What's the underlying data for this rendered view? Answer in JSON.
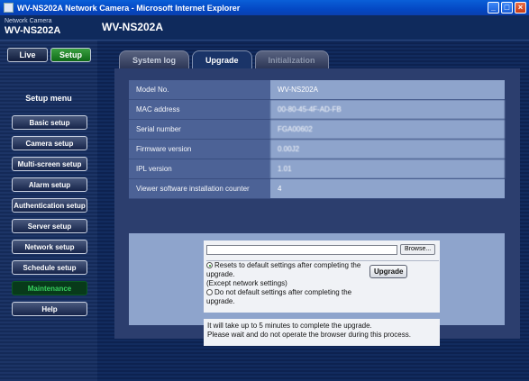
{
  "window": {
    "title": "WV-NS202A Network Camera - Microsoft Internet Explorer",
    "buttons": [
      "_",
      "□",
      "×"
    ]
  },
  "header": {
    "brand_small": "Network Camera",
    "brand_model": "WV-NS202A",
    "page_title": "WV-NS202A"
  },
  "modes": {
    "live": "Live",
    "setup": "Setup"
  },
  "sidebar": {
    "menu_label": "Setup menu",
    "items": [
      {
        "label": "Basic setup"
      },
      {
        "label": "Camera setup"
      },
      {
        "label": "Multi-screen setup"
      },
      {
        "label": "Alarm setup"
      },
      {
        "label": "Authentication setup"
      },
      {
        "label": "Server setup"
      },
      {
        "label": "Network setup"
      },
      {
        "label": "Schedule setup"
      },
      {
        "label": "Maintenance"
      },
      {
        "label": "Help"
      }
    ]
  },
  "tabs": [
    {
      "label": "System log"
    },
    {
      "label": "Upgrade"
    },
    {
      "label": "Initialization"
    }
  ],
  "info": {
    "rows": [
      {
        "label": "Model No.",
        "value": "WV-NS202A"
      },
      {
        "label": "MAC address",
        "value": "00-80-45-4F-AD-FB"
      },
      {
        "label": "Serial number",
        "value": "FGA00602"
      },
      {
        "label": "Firmware version",
        "value": "0.00J2"
      },
      {
        "label": "IPL version",
        "value": "1.01"
      },
      {
        "label": "Viewer software installation counter",
        "value": "4"
      }
    ]
  },
  "upgrade": {
    "file_value": "",
    "browse_label": "Browse...",
    "option1": "Resets to default settings after completing the upgrade.",
    "option1_note": "(Except network settings)",
    "option2": "Do not default settings after completing the upgrade.",
    "upgrade_button": "Upgrade",
    "note_line1": "It will take up to 5 minutes to complete the upgrade.",
    "note_line2": "Please wait and do not operate the browser during this process."
  }
}
